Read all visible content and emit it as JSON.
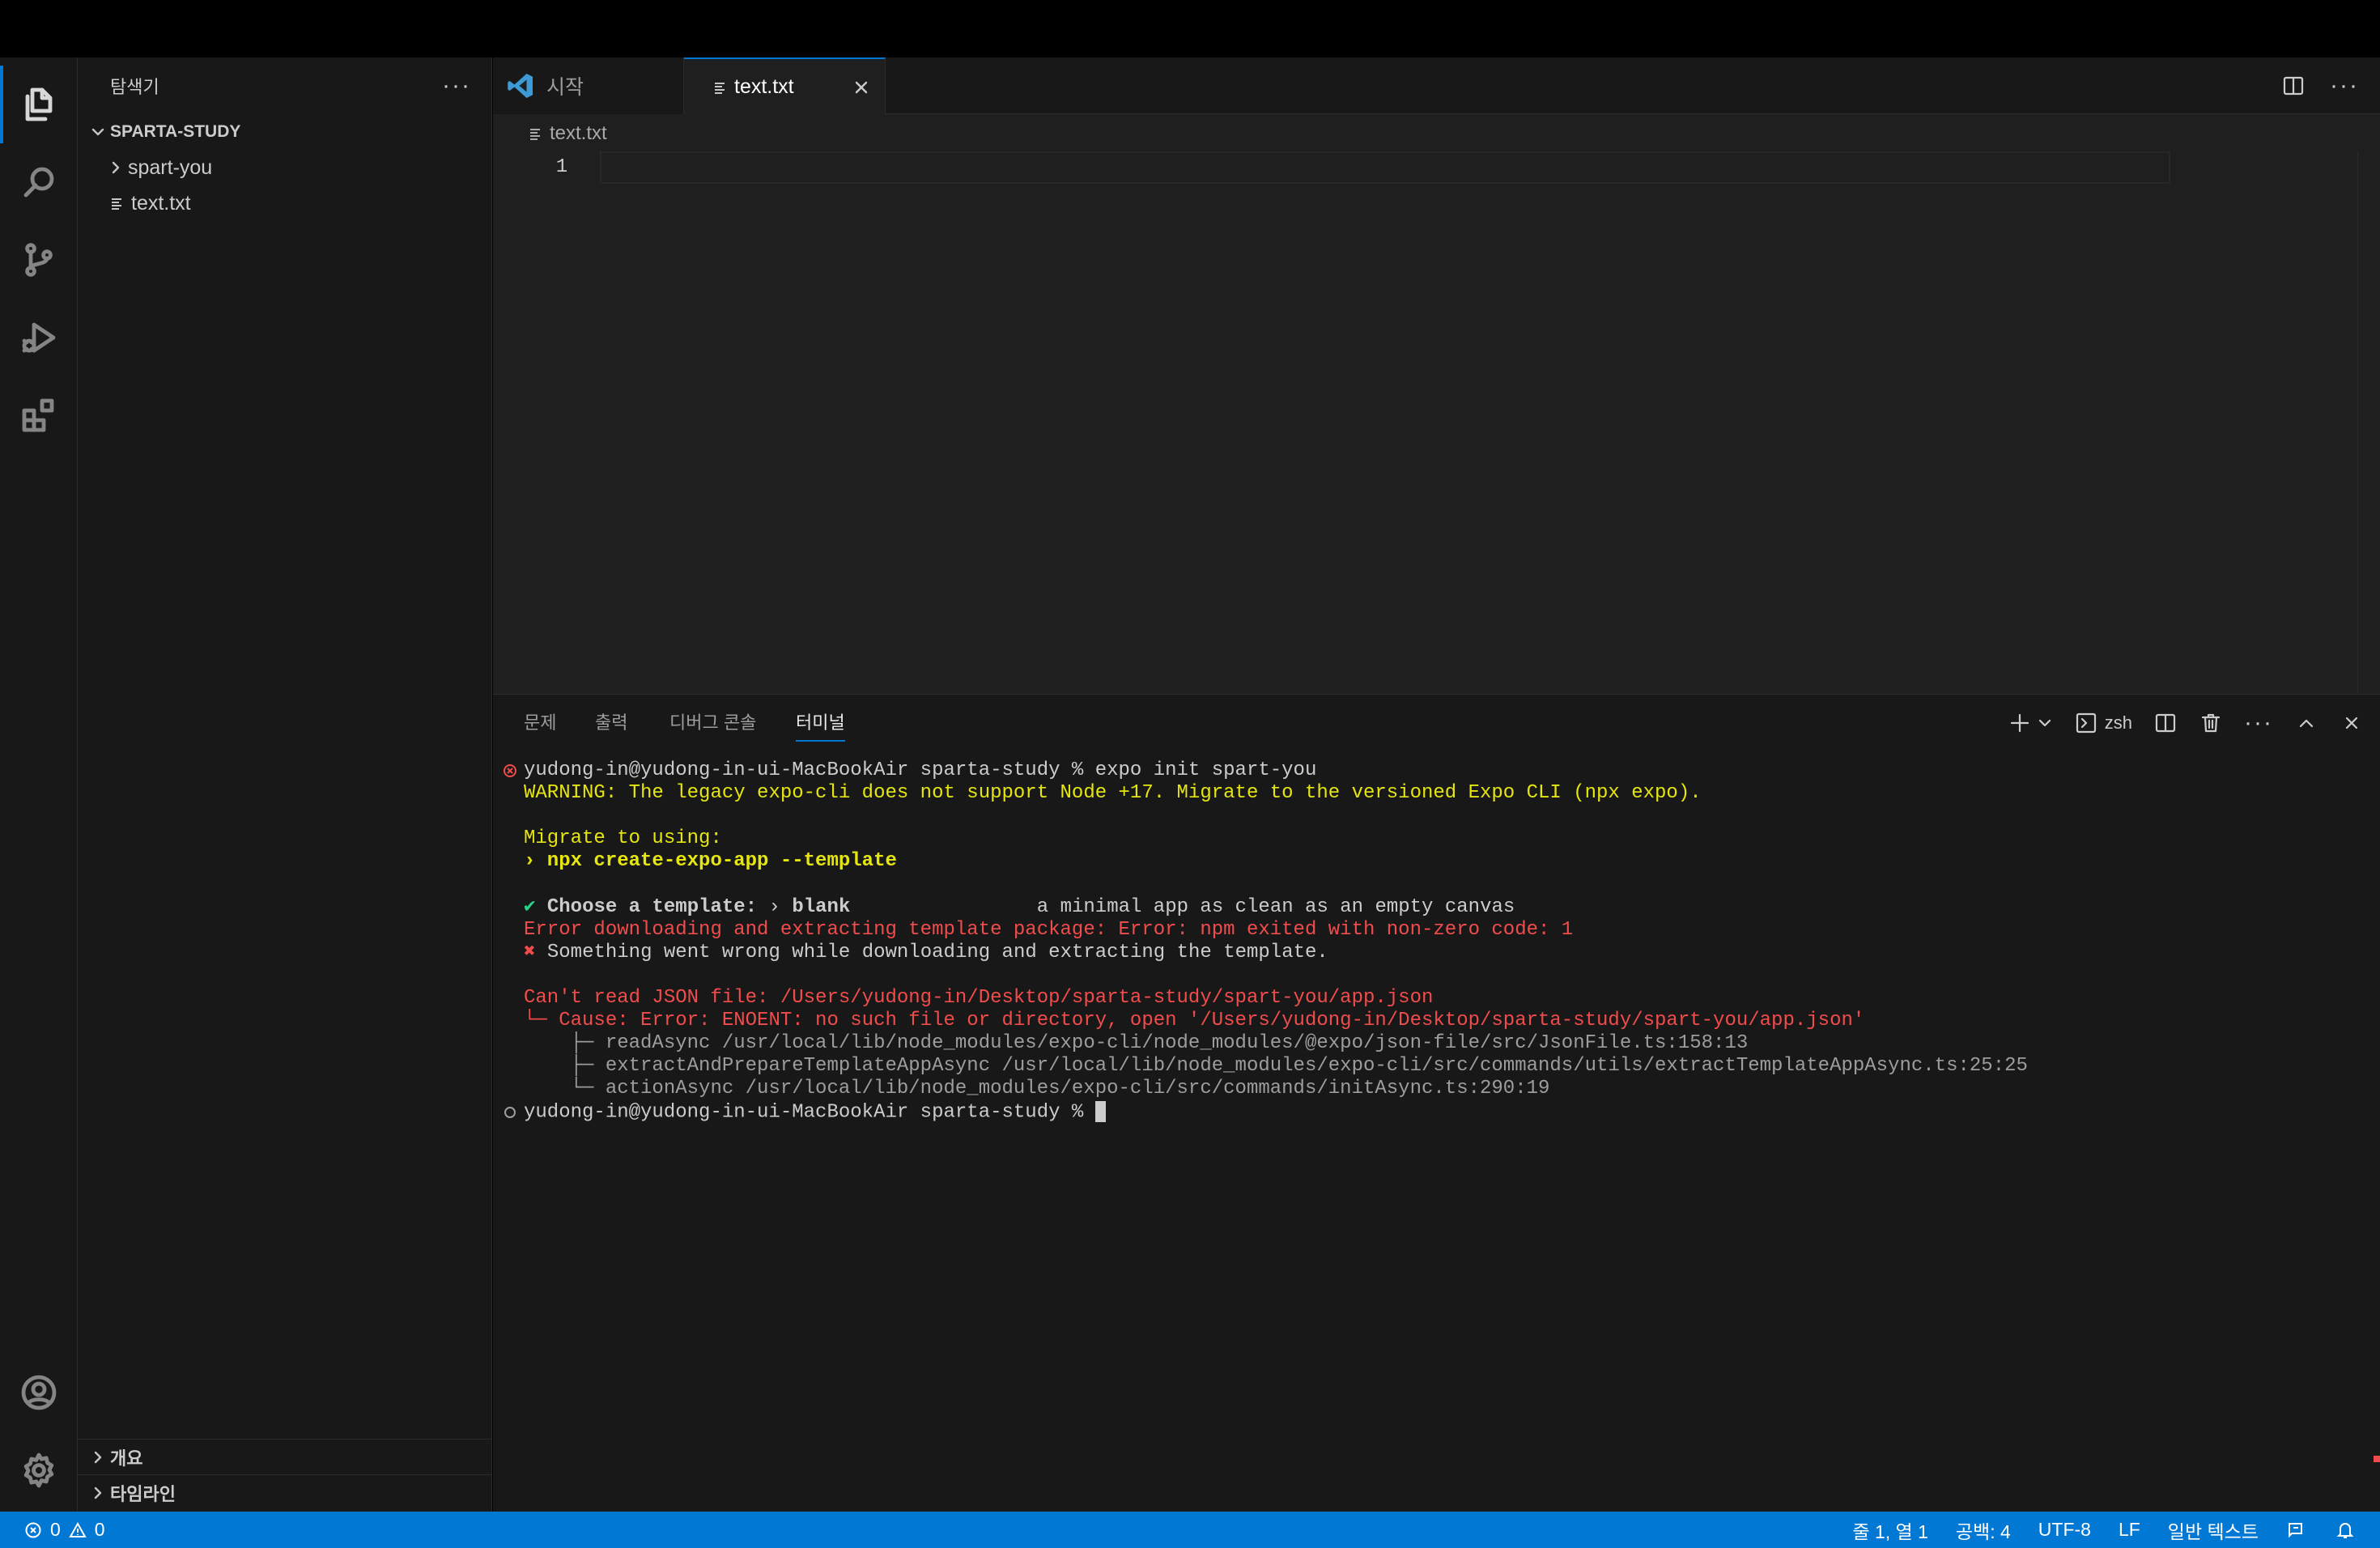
{
  "sidebar": {
    "title": "탐색기",
    "more": "···",
    "folder": "SPARTA-STUDY",
    "items": [
      {
        "label": "spart-you",
        "type": "folder"
      },
      {
        "label": "text.txt",
        "type": "file"
      }
    ],
    "sections": [
      {
        "label": "개요"
      },
      {
        "label": "타임라인"
      }
    ]
  },
  "tabs": [
    {
      "label": "시작",
      "active": false,
      "icon": "vscode-logo-icon"
    },
    {
      "label": "text.txt",
      "active": true,
      "icon": "text-file-icon"
    }
  ],
  "editor": {
    "breadcrumb": "text.txt",
    "line_number": "1"
  },
  "panel": {
    "tabs": [
      {
        "label": "문제"
      },
      {
        "label": "출력"
      },
      {
        "label": "디버그 콘솔"
      },
      {
        "label": "터미널",
        "active": true
      }
    ],
    "shell": "zsh"
  },
  "terminal": {
    "lines": [
      {
        "text": "yudong-in@yudong-in-ui-MacBookAir sparta-study % expo init spart-you",
        "color": "white",
        "deco": "error"
      },
      {
        "text": "WARNING: The legacy expo-cli does not support Node +17. Migrate to the versioned Expo CLI (npx expo).",
        "color": "yellow"
      },
      {
        "text": "",
        "color": "white"
      },
      {
        "text": "Migrate to using:",
        "color": "yellow"
      },
      {
        "text": "› npx create-expo-app --template",
        "color": "yellow",
        "bold": true
      },
      {
        "text": "",
        "color": "white"
      },
      {
        "prefix": "✔ ",
        "prefix_color": "green",
        "text": "Choose a template: › blank                a minimal app as clean as an empty canvas",
        "color": "white",
        "bold_part": "Choose a template:"
      },
      {
        "text": "Error downloading and extracting template package: Error: npm exited with non-zero code: 1",
        "color": "red"
      },
      {
        "prefix": "✖ ",
        "prefix_color": "red",
        "text": "Something went wrong while downloading and extracting the template.",
        "color": "white"
      },
      {
        "text": "",
        "color": "white"
      },
      {
        "text": "Can't read JSON file: /Users/yudong-in/Desktop/sparta-study/spart-you/app.json",
        "color": "red"
      },
      {
        "text": "└─ Cause: Error: ENOENT: no such file or directory, open '/Users/yudong-in/Desktop/sparta-study/spart-you/app.json'",
        "color": "red"
      },
      {
        "text": "    ├─ readAsync /usr/local/lib/node_modules/expo-cli/node_modules/@expo/json-file/src/JsonFile.ts:158:13",
        "color": "gray"
      },
      {
        "text": "    ├─ extractAndPrepareTemplateAppAsync /usr/local/lib/node_modules/expo-cli/src/commands/utils/extractTemplateAppAsync.ts:25:25",
        "color": "gray"
      },
      {
        "text": "    └─ actionAsync /usr/local/lib/node_modules/expo-cli/src/commands/initAsync.ts:290:19",
        "color": "gray"
      },
      {
        "text": "yudong-in@yudong-in-ui-MacBookAir sparta-study % ",
        "color": "white",
        "deco": "idle",
        "cursor": true
      }
    ]
  },
  "statusbar": {
    "errors": "0",
    "warnings": "0",
    "position": "줄 1, 열 1",
    "spaces": "공백: 4",
    "encoding": "UTF-8",
    "eol": "LF",
    "language": "일반 텍스트"
  },
  "colors": {
    "accent": "#0078d4",
    "statusbar": "#0078d4",
    "terminal_yellow": "#e5e510",
    "terminal_red": "#f14c4c",
    "terminal_green": "#23d18b"
  }
}
